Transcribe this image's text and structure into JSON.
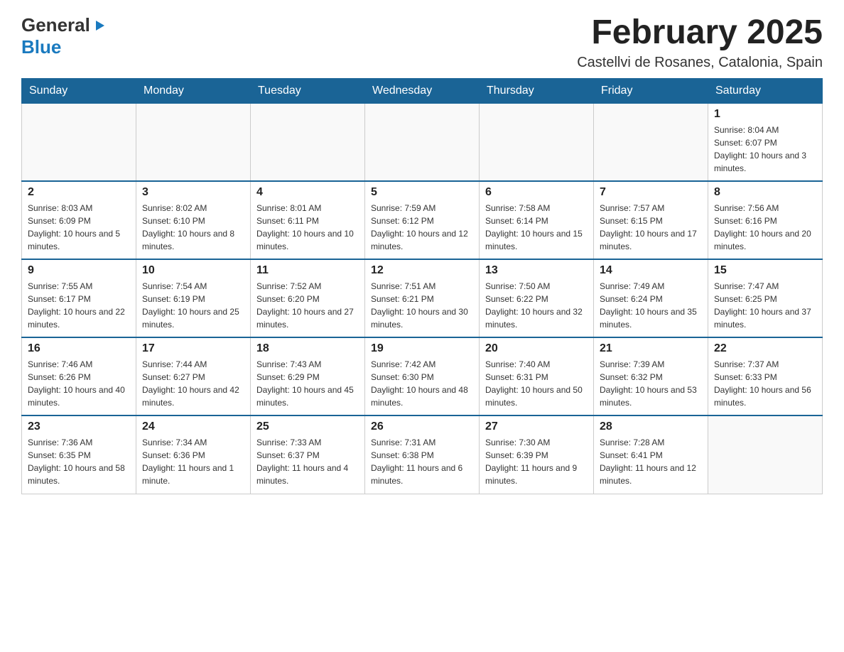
{
  "header": {
    "logo_general": "General",
    "logo_blue": "Blue",
    "title": "February 2025",
    "subtitle": "Castellvi de Rosanes, Catalonia, Spain"
  },
  "calendar": {
    "days_of_week": [
      "Sunday",
      "Monday",
      "Tuesday",
      "Wednesday",
      "Thursday",
      "Friday",
      "Saturday"
    ],
    "weeks": [
      [
        {
          "day": "",
          "info": ""
        },
        {
          "day": "",
          "info": ""
        },
        {
          "day": "",
          "info": ""
        },
        {
          "day": "",
          "info": ""
        },
        {
          "day": "",
          "info": ""
        },
        {
          "day": "",
          "info": ""
        },
        {
          "day": "1",
          "info": "Sunrise: 8:04 AM\nSunset: 6:07 PM\nDaylight: 10 hours and 3 minutes."
        }
      ],
      [
        {
          "day": "2",
          "info": "Sunrise: 8:03 AM\nSunset: 6:09 PM\nDaylight: 10 hours and 5 minutes."
        },
        {
          "day": "3",
          "info": "Sunrise: 8:02 AM\nSunset: 6:10 PM\nDaylight: 10 hours and 8 minutes."
        },
        {
          "day": "4",
          "info": "Sunrise: 8:01 AM\nSunset: 6:11 PM\nDaylight: 10 hours and 10 minutes."
        },
        {
          "day": "5",
          "info": "Sunrise: 7:59 AM\nSunset: 6:12 PM\nDaylight: 10 hours and 12 minutes."
        },
        {
          "day": "6",
          "info": "Sunrise: 7:58 AM\nSunset: 6:14 PM\nDaylight: 10 hours and 15 minutes."
        },
        {
          "day": "7",
          "info": "Sunrise: 7:57 AM\nSunset: 6:15 PM\nDaylight: 10 hours and 17 minutes."
        },
        {
          "day": "8",
          "info": "Sunrise: 7:56 AM\nSunset: 6:16 PM\nDaylight: 10 hours and 20 minutes."
        }
      ],
      [
        {
          "day": "9",
          "info": "Sunrise: 7:55 AM\nSunset: 6:17 PM\nDaylight: 10 hours and 22 minutes."
        },
        {
          "day": "10",
          "info": "Sunrise: 7:54 AM\nSunset: 6:19 PM\nDaylight: 10 hours and 25 minutes."
        },
        {
          "day": "11",
          "info": "Sunrise: 7:52 AM\nSunset: 6:20 PM\nDaylight: 10 hours and 27 minutes."
        },
        {
          "day": "12",
          "info": "Sunrise: 7:51 AM\nSunset: 6:21 PM\nDaylight: 10 hours and 30 minutes."
        },
        {
          "day": "13",
          "info": "Sunrise: 7:50 AM\nSunset: 6:22 PM\nDaylight: 10 hours and 32 minutes."
        },
        {
          "day": "14",
          "info": "Sunrise: 7:49 AM\nSunset: 6:24 PM\nDaylight: 10 hours and 35 minutes."
        },
        {
          "day": "15",
          "info": "Sunrise: 7:47 AM\nSunset: 6:25 PM\nDaylight: 10 hours and 37 minutes."
        }
      ],
      [
        {
          "day": "16",
          "info": "Sunrise: 7:46 AM\nSunset: 6:26 PM\nDaylight: 10 hours and 40 minutes."
        },
        {
          "day": "17",
          "info": "Sunrise: 7:44 AM\nSunset: 6:27 PM\nDaylight: 10 hours and 42 minutes."
        },
        {
          "day": "18",
          "info": "Sunrise: 7:43 AM\nSunset: 6:29 PM\nDaylight: 10 hours and 45 minutes."
        },
        {
          "day": "19",
          "info": "Sunrise: 7:42 AM\nSunset: 6:30 PM\nDaylight: 10 hours and 48 minutes."
        },
        {
          "day": "20",
          "info": "Sunrise: 7:40 AM\nSunset: 6:31 PM\nDaylight: 10 hours and 50 minutes."
        },
        {
          "day": "21",
          "info": "Sunrise: 7:39 AM\nSunset: 6:32 PM\nDaylight: 10 hours and 53 minutes."
        },
        {
          "day": "22",
          "info": "Sunrise: 7:37 AM\nSunset: 6:33 PM\nDaylight: 10 hours and 56 minutes."
        }
      ],
      [
        {
          "day": "23",
          "info": "Sunrise: 7:36 AM\nSunset: 6:35 PM\nDaylight: 10 hours and 58 minutes."
        },
        {
          "day": "24",
          "info": "Sunrise: 7:34 AM\nSunset: 6:36 PM\nDaylight: 11 hours and 1 minute."
        },
        {
          "day": "25",
          "info": "Sunrise: 7:33 AM\nSunset: 6:37 PM\nDaylight: 11 hours and 4 minutes."
        },
        {
          "day": "26",
          "info": "Sunrise: 7:31 AM\nSunset: 6:38 PM\nDaylight: 11 hours and 6 minutes."
        },
        {
          "day": "27",
          "info": "Sunrise: 7:30 AM\nSunset: 6:39 PM\nDaylight: 11 hours and 9 minutes."
        },
        {
          "day": "28",
          "info": "Sunrise: 7:28 AM\nSunset: 6:41 PM\nDaylight: 11 hours and 12 minutes."
        },
        {
          "day": "",
          "info": ""
        }
      ]
    ]
  }
}
